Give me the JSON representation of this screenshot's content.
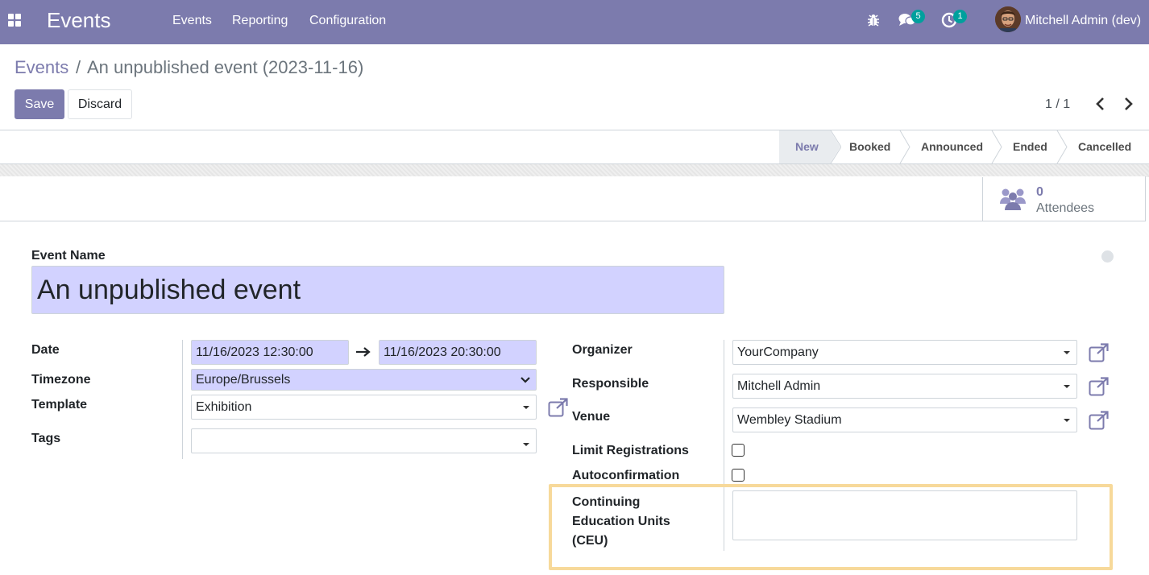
{
  "navbar": {
    "app_title": "Events",
    "menu": [
      "Events",
      "Reporting",
      "Configuration"
    ],
    "messages_count": "5",
    "activities_count": "1",
    "user_name": "Mitchell Admin (dev)"
  },
  "breadcrumb": {
    "parent": "Events",
    "separator": "/",
    "current": "An unpublished event (2023-11-16)"
  },
  "buttons": {
    "save": "Save",
    "discard": "Discard"
  },
  "pager": {
    "value": "1 / 1"
  },
  "stages": [
    {
      "label": "New",
      "current": true
    },
    {
      "label": "Booked",
      "current": false
    },
    {
      "label": "Announced",
      "current": false
    },
    {
      "label": "Ended",
      "current": false
    },
    {
      "label": "Cancelled",
      "current": false
    }
  ],
  "stat_button": {
    "value": "0",
    "label": "Attendees"
  },
  "form": {
    "event_name_label": "Event Name",
    "event_name_value": "An unpublished event",
    "left": {
      "date_label": "Date",
      "date_start": "11/16/2023 12:30:00",
      "date_end": "11/16/2023 20:30:00",
      "timezone_label": "Timezone",
      "timezone_value": "Europe/Brussels",
      "template_label": "Template",
      "template_value": "Exhibition",
      "tags_label": "Tags",
      "tags_value": ""
    },
    "right": {
      "organizer_label": "Organizer",
      "organizer_value": "YourCompany",
      "responsible_label": "Responsible",
      "responsible_value": "Mitchell Admin",
      "venue_label": "Venue",
      "venue_value": "Wembley Stadium",
      "limit_label": "Limit Registrations",
      "limit_checked": false,
      "autoconf_label": "Autoconfirmation",
      "autoconf_checked": false,
      "ceu_label_line1": "Continuing",
      "ceu_label_line2": "Education Units",
      "ceu_label_line3": "(CEU)",
      "ceu_value": ""
    }
  },
  "colors": {
    "navbar": "#7c7bad",
    "primary": "#7c7bad",
    "required_field": "#d2d2ff",
    "highlight_box": "#f7d99a",
    "badge": "#00a09d"
  }
}
